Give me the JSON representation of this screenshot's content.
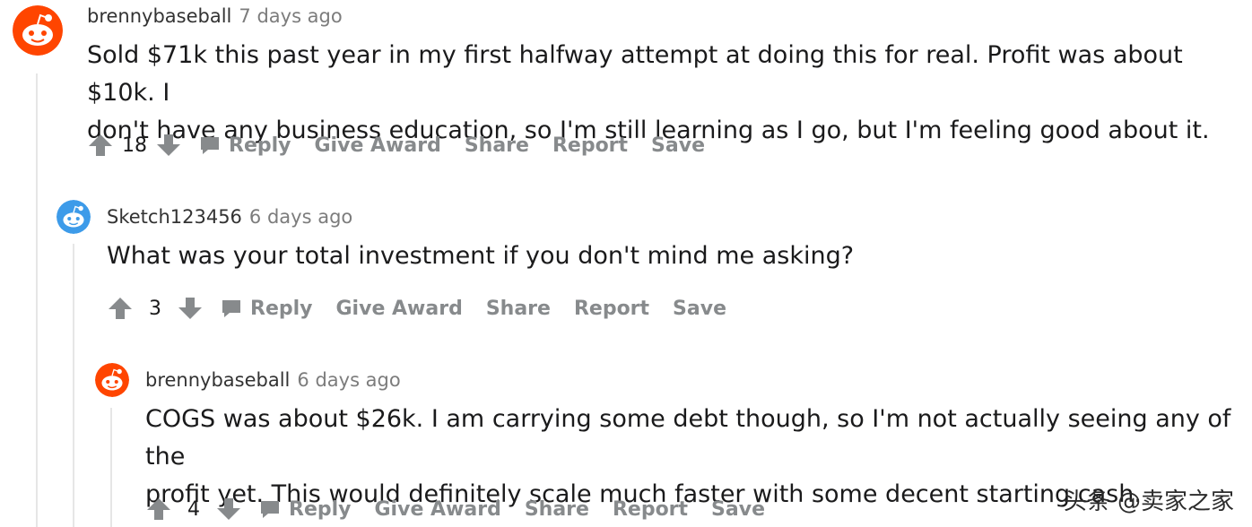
{
  "comments": [
    {
      "author": "brennybaseball",
      "time": "7 days ago",
      "body": "Sold $71k this past year in my first halfway attempt at doing this for real. Profit was about $10k. I\ndon't have any business education, so I'm still learning as I go, but I'm feeling good about it.",
      "score": "18",
      "avatar_color": "#ff4500"
    },
    {
      "author": "Sketch123456",
      "time": "6 days ago",
      "body": "What was your total investment if you don't mind me asking?",
      "score": "3",
      "avatar_color": "#3d9be9"
    },
    {
      "author": "brennybaseball",
      "time": "6 days ago",
      "body": "COGS was about $26k. I am carrying some debt though, so I'm not actually seeing any of the\nprofit yet. This would definitely scale much faster with some decent starting cash.",
      "score": "4",
      "avatar_color": "#ff4500"
    }
  ],
  "actions": {
    "reply": "Reply",
    "give_award": "Give Award",
    "share": "Share",
    "report": "Report",
    "save": "Save"
  },
  "icons": {
    "upvote": "upvote-arrow-icon",
    "downvote": "downvote-arrow-icon",
    "reply": "speech-bubble-icon",
    "avatar": "snoo-avatar-icon"
  },
  "watermark": "头条 @卖家之家"
}
